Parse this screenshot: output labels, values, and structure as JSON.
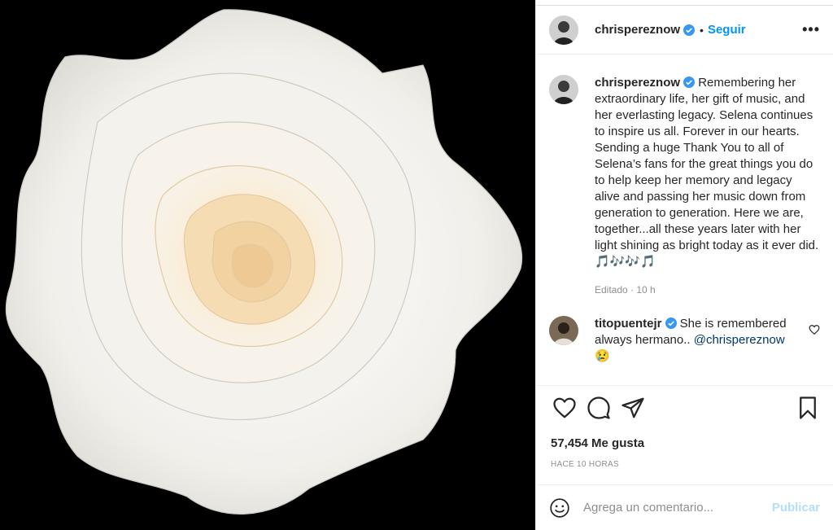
{
  "post": {
    "author": "chrispereznow",
    "follow_label": "Seguir",
    "separator": "•",
    "more_label": "•••",
    "caption": {
      "author": "chrispereznow",
      "text": "Remembering her extraordinary life, her gift of music, and her everlasting legacy. Selena continues to inspire us all. Forever in our hearts. Sending a huge Thank You to all of Selena’s fans for the great things you do to help keep her memory and legacy alive and passing her music down from generation to generation. Here we are, together...all these years later with her light shining as bright today as it ever did.",
      "emojis": "🎵🎶🎶🎵",
      "meta": "Editado · 10 h"
    },
    "comments": [
      {
        "author": "titopuentejr",
        "text": "She is remembered always hermano.. ",
        "mention": "@chrispereznow",
        "emoji": "😢"
      }
    ],
    "likes": "57,454 Me gusta",
    "time": "HACE 10 HORAS",
    "comment_placeholder": "Agrega un comentario...",
    "publish_label": "Publicar"
  },
  "icons": {
    "verified": "verified-badge-icon",
    "like": "heart-icon",
    "comment": "comment-bubble-icon",
    "share": "paper-plane-icon",
    "save": "bookmark-icon",
    "emoji": "smiley-icon"
  },
  "colors": {
    "accent": "#0095f6",
    "publish_disabled": "#b2dffc",
    "media_background": "#000000",
    "muted": "#8e8e8e"
  }
}
